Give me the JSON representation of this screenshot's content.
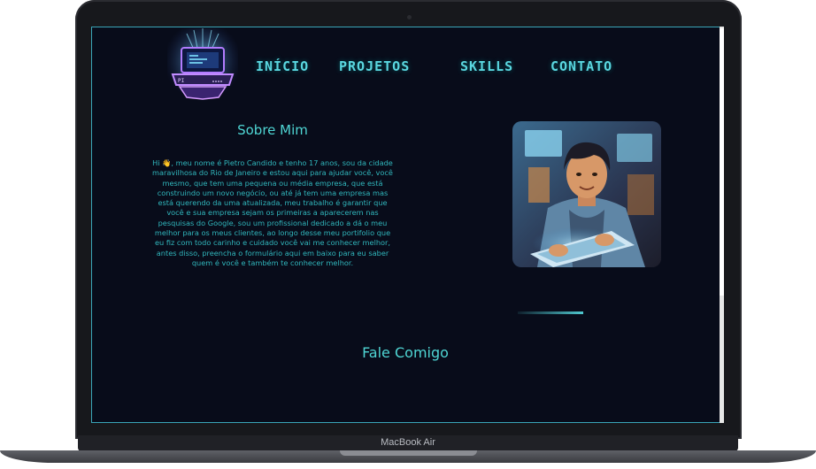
{
  "device": {
    "label": "MacBook Air"
  },
  "nav": {
    "items": [
      {
        "label": "INÍCIO"
      },
      {
        "label": "PROJETOS"
      },
      {
        "label": "SKILLS"
      },
      {
        "label": "CONTATO"
      }
    ]
  },
  "logo": {
    "text": "PI"
  },
  "about": {
    "title": "Sobre Mim",
    "text": "Hi 👋, meu nome é Pietro Candido e tenho 17 anos, sou da cidade maravilhosa do Rio de Janeiro e estou aqui para ajudar você, você mesmo, que tem uma pequena ou média empresa, que está construindo um novo negócio, ou até já tem uma empresa mas está querendo da uma atualizada, meu trabalho é garantir que você e sua empresa sejam os primeiras a aparecerem nas pesquisas do Google, sou um profissional dedicado a dá o meu melhor para os meus clientes, ao longo desse meu portifolio que eu fiz com todo carinho e cuidado você vai me conhecer melhor, antes disso, preencha o formulário aqui em baixo para eu saber quem é você e também te conhecer melhor."
  },
  "contact": {
    "title": "Fale Comigo"
  },
  "colors": {
    "accent": "#4fd6d4",
    "background": "#080c1a"
  },
  "icons": {
    "logo": "laptop-logo-icon",
    "avatar": "developer-avatar-illustration"
  }
}
